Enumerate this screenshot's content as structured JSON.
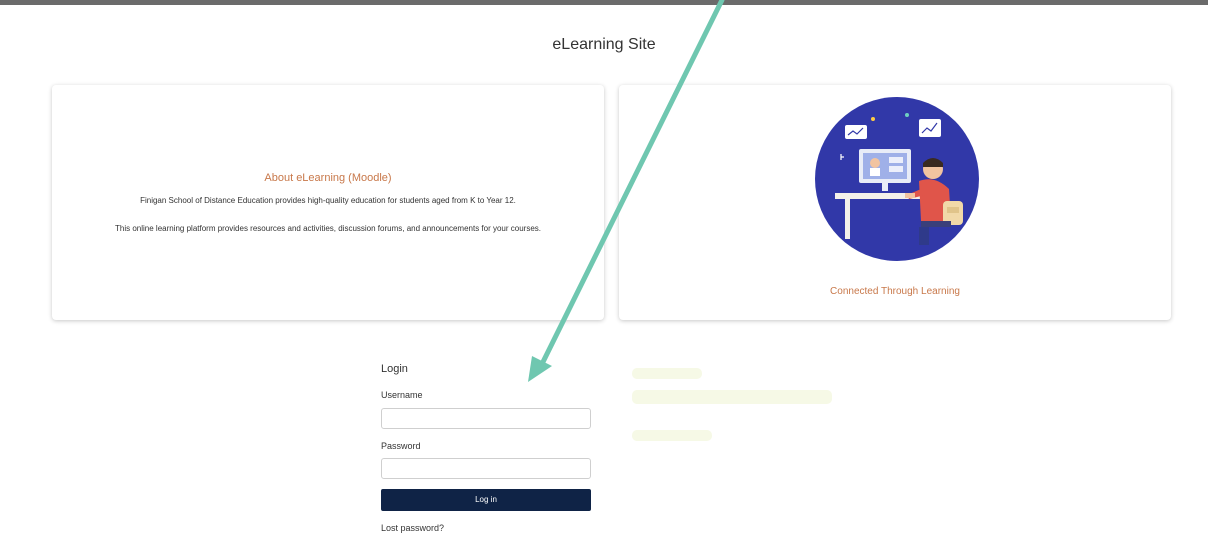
{
  "site": {
    "title": "eLearning Site"
  },
  "about": {
    "title": "About eLearning (Moodle)",
    "line1": "Finigan School of Distance Education provides high-quality education for students aged from K to Year 12.",
    "line2": "This online learning platform provides resources and activities, discussion forums, and announcements for your courses."
  },
  "promo": {
    "caption": "Connected Through Learning"
  },
  "login": {
    "heading": "Login",
    "username_label": "Username",
    "username_value": "",
    "password_label": "Password",
    "password_value": "",
    "button_label": "Log in",
    "lost_password": "Lost password?"
  },
  "colors": {
    "accent": "#c8784a",
    "button": "#0f2346",
    "arrow": "#6fc7b0",
    "illustration_bg": "#3138a8"
  }
}
